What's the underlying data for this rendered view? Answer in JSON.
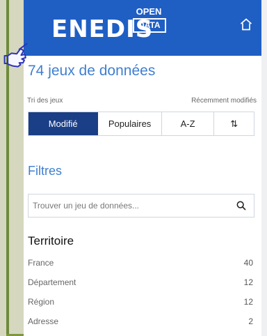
{
  "header": {
    "brand": "ENEDIS",
    "badge_top": "OPEN",
    "badge_bottom": "DATA",
    "home_icon": "home-icon"
  },
  "page": {
    "title": "74 jeux de données",
    "sort_label": "Tri des jeux",
    "sort_hint": "Récemment modifiés",
    "tabs": [
      {
        "label": "Modifié",
        "active": true
      },
      {
        "label": "Populaires",
        "active": false
      },
      {
        "label": "A-Z",
        "active": false
      },
      {
        "label": "⇅",
        "active": false
      }
    ]
  },
  "filters": {
    "title": "Filtres",
    "search_placeholder": "Trouver un jeu de données...",
    "territory_title": "Territoire",
    "items": [
      {
        "label": "France",
        "count": "40"
      },
      {
        "label": "Département",
        "count": "12"
      },
      {
        "label": "Région",
        "count": "12"
      },
      {
        "label": "Adresse",
        "count": "2"
      }
    ]
  }
}
